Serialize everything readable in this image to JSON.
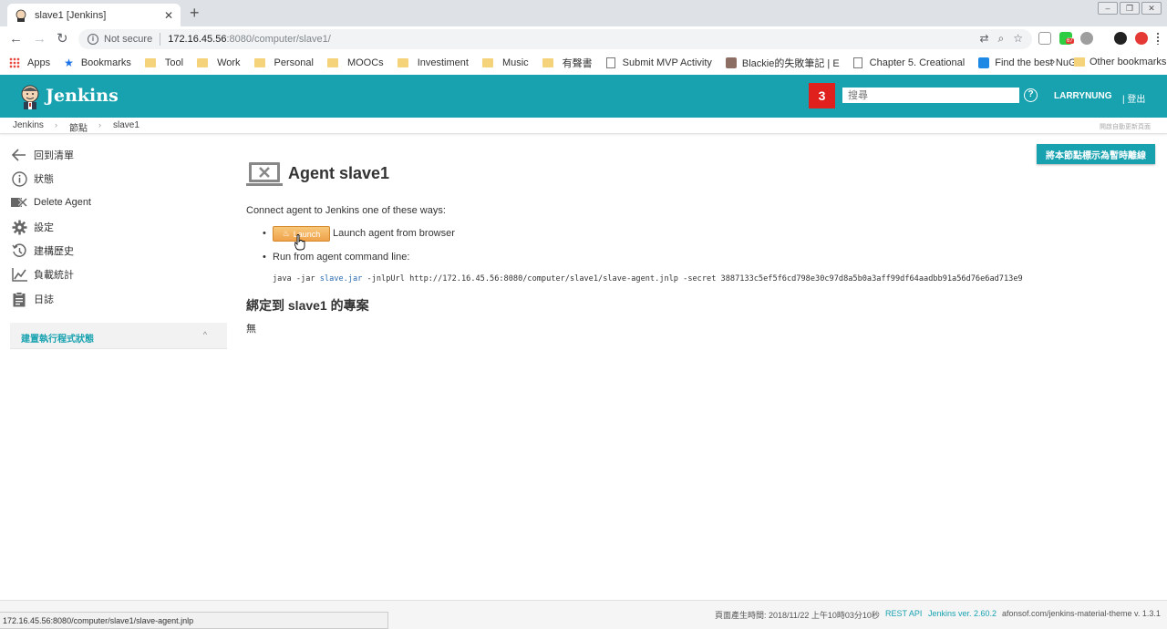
{
  "browser": {
    "tab_title": "slave1 [Jenkins]",
    "new_tab": "+",
    "security_label": "Not secure",
    "url_host": "172.16.45.56",
    "url_path": ":8080/computer/slave1/",
    "status_url": "172.16.45.56:8080/computer/slave1/slave-agent.jnlp",
    "bookmarks": [
      {
        "label": "Apps",
        "icon": "apps-grid-icon"
      },
      {
        "label": "Bookmarks",
        "icon": "star-icon"
      },
      {
        "label": "Tool",
        "icon": "folder-icon"
      },
      {
        "label": "Work",
        "icon": "folder-icon"
      },
      {
        "label": "Personal",
        "icon": "folder-icon"
      },
      {
        "label": "MOOCs",
        "icon": "folder-icon"
      },
      {
        "label": "Investiment",
        "icon": "folder-icon"
      },
      {
        "label": "Music",
        "icon": "folder-icon"
      },
      {
        "label": "有聲書",
        "icon": "folder-icon"
      },
      {
        "label": "Submit MVP Activity",
        "icon": "page-icon"
      },
      {
        "label": "Blackie的失敗筆記 | E",
        "icon": "avatar-icon"
      },
      {
        "label": "Chapter 5. Creational",
        "icon": "page-icon"
      },
      {
        "label": "Find the best NuGet",
        "icon": "nuget-icon"
      }
    ],
    "more_bookmarks": "»",
    "other_bookmarks": "Other bookmarks",
    "extension_badge": "67"
  },
  "header": {
    "brand": "Jenkins",
    "notification_count": "3",
    "search_placeholder": "搜尋",
    "help": "?",
    "user": "LARRYNUNG",
    "logout": "| 登出"
  },
  "breadcrumbs": [
    "Jenkins",
    "節點",
    "slave1"
  ],
  "breadcrumb_sep": "›",
  "auto_refresh": "開啟自動更新頁面",
  "sidebar": {
    "items": [
      {
        "label": "回到清單",
        "icon": "arrow-left-icon"
      },
      {
        "label": "狀態",
        "icon": "info-icon"
      },
      {
        "label": "Delete Agent",
        "icon": "delete-icon"
      },
      {
        "label": "設定",
        "icon": "gear-icon"
      },
      {
        "label": "建構歷史",
        "icon": "history-icon"
      },
      {
        "label": "負載統計",
        "icon": "chart-icon"
      },
      {
        "label": "日誌",
        "icon": "clipboard-icon"
      }
    ],
    "executor_panel": "建置執行程式狀態",
    "executor_chevron": "^"
  },
  "main": {
    "temp_offline_button": "將本節點標示為暫時離線",
    "title": "Agent slave1",
    "connect_text": "Connect agent to Jenkins one of these ways:",
    "launch_button": "Launch",
    "launch_desc": "Launch agent from browser",
    "run_desc": "Run from agent command line:",
    "cmd_prefix": "java -jar ",
    "cmd_jar": "slave.jar",
    "cmd_rest": " -jnlpUrl http://172.16.45.56:8080/computer/slave1/slave-agent.jnlp -secret 3887133c5ef5f6cd798e30c97d8a5b0a3aff99df64aadbb91a56d76e6ad713e9",
    "projects_title": "綁定到 slave1 的專案",
    "projects_none": "無",
    "bullet": "•"
  },
  "footer": {
    "generated": "頁面產生時間: 2018/11/22 上午10時03分10秒",
    "rest_api": "REST API",
    "version": "Jenkins ver. 2.60.2",
    "theme": "afonsof.com/jenkins-material-theme v. 1.3.1"
  },
  "colors": {
    "jenkins_teal": "#18a2b0",
    "badge_red": "#e0201d",
    "launch_orange": "#f0a24a"
  }
}
